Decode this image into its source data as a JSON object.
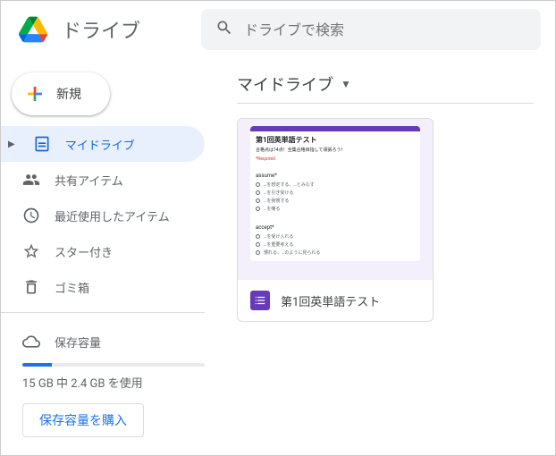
{
  "header": {
    "app_title": "ドライブ",
    "search_placeholder": "ドライブで検索"
  },
  "sidebar": {
    "new_label": "新規",
    "items": [
      {
        "label": "マイドライブ"
      },
      {
        "label": "共有アイテム"
      },
      {
        "label": "最近使用したアイテム"
      },
      {
        "label": "スター付き"
      },
      {
        "label": "ゴミ箱"
      }
    ],
    "storage": {
      "label": "保存容量",
      "usage_text": "15 GB 中 2.4 GB を使用",
      "buy_label": "保存容量を購入"
    }
  },
  "content": {
    "title": "マイドライブ",
    "files": [
      {
        "name": "第1回英単語テスト",
        "preview": {
          "title": "第1回英単語テスト",
          "subtitle": "合格点は14点！全集合格目指して頑張ろう！",
          "required": "*Required",
          "q1_title": "assume*",
          "q1_opts": [
            "…を想定する、…とみなす",
            "…を引き受ける",
            "…を我慢する",
            "…を嘲る"
          ],
          "q2_title": "accept*",
          "q2_opts": [
            "…を受け入れる",
            "…を重要考える",
            "慣れる、…のように見られる"
          ]
        }
      }
    ]
  }
}
